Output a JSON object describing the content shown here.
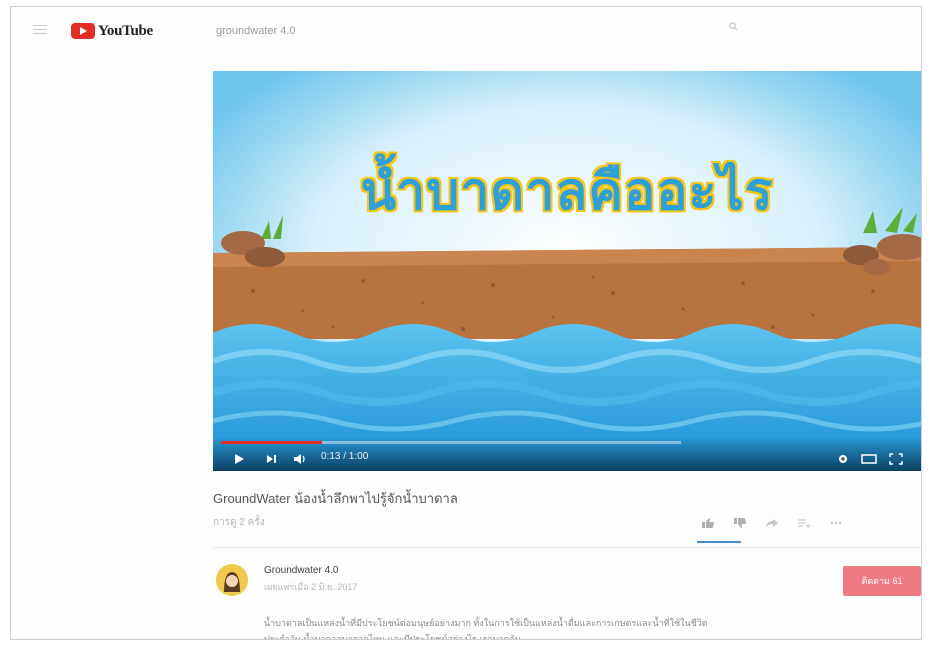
{
  "header": {
    "logo_text": "YouTube",
    "search_value": "groundwater 4.0"
  },
  "video": {
    "overlay_title": "น้ำบาดาลคืออะไร",
    "time_display": "0:13 / 1:00",
    "progress_percent": 22,
    "title": "GroundWater น้องน้ำลึกพาไปรู้จักน้ำบาดาล",
    "views": "การดู 2 ครั้ง"
  },
  "channel": {
    "name": "Groundwater 4.0",
    "published": "เผยแพร่เมื่อ 2 มิ.ย. 2017",
    "subscribe_label": "ติดตาม  61"
  },
  "description": {
    "line1": "น้ำบาดาลเป็นแหล่งน้ำที่มีประโยชน์ต่อมนุษย์อย่างมาก ทั้งในการใช้เป็นแหล่งน้ำดื่มและการเกษตรและน้ำที่ใช้ในชีวิต",
    "line2": "ประจำวัน น้ำบาดาลมาจากไหน และมีประโยชน์อย่างไร เรามาดูกัน"
  },
  "colors": {
    "youtube_red": "#e52d27",
    "subscribe_bg": "#f07a82",
    "progress": "#e52d27",
    "title_text": "#2f9fd8"
  },
  "icons": [
    "menu-icon",
    "youtube-logo-icon",
    "search-icon",
    "play-icon",
    "next-icon",
    "volume-icon",
    "settings-icon",
    "theater-icon",
    "fullscreen-icon",
    "like-icon",
    "dislike-icon",
    "share-icon",
    "add-to-icon",
    "more-icon"
  ]
}
